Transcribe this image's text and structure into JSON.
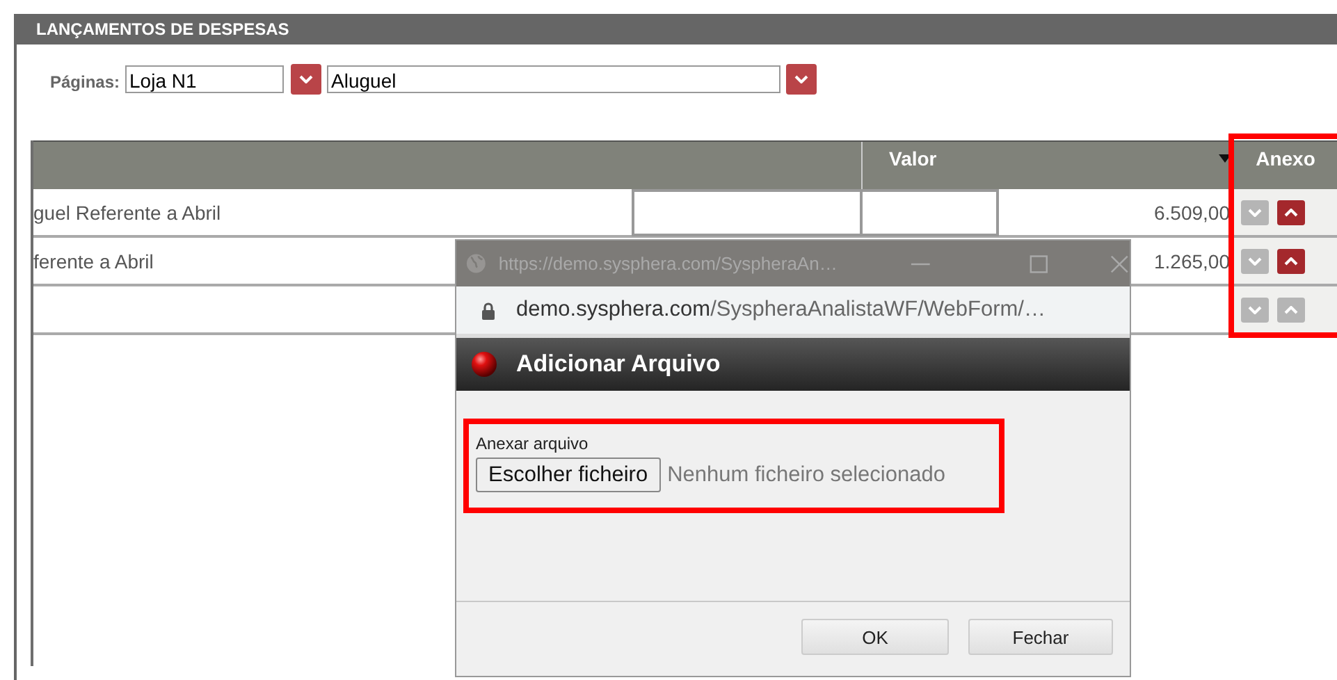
{
  "panel": {
    "title": "LANÇAMENTOS DE DESPESAS"
  },
  "filters": {
    "label": "Páginas:",
    "store": "Loja N1",
    "account": "Aluguel"
  },
  "table": {
    "columns": [
      {
        "label": "Valor",
        "sortable": true
      },
      {
        "label": "Anexo",
        "sortable": false
      }
    ],
    "rows": [
      {
        "description": "guel Referente a Abril",
        "edit_fields": true,
        "value": "6.509,00",
        "upload_enabled": true
      },
      {
        "description": "ferente a Abril",
        "edit_fields": false,
        "value": "1.265,00",
        "upload_enabled": true
      },
      {
        "edit_fields": false,
        "upload_enabled": false
      }
    ]
  },
  "popup": {
    "browser_title": "https://demo.sysphera.com/SyspheraAn…",
    "address_domain": "demo.sysphera.com",
    "address_path": "/SyspheraAnalistaWF/WebForm/…",
    "title": "Adicionar Arquivo",
    "field_label": "Anexar arquivo",
    "choose_button": "Escolher ficheiro",
    "file_status": "Nenhum ficheiro selecionado",
    "buttons": [
      "OK",
      "Fechar"
    ]
  }
}
